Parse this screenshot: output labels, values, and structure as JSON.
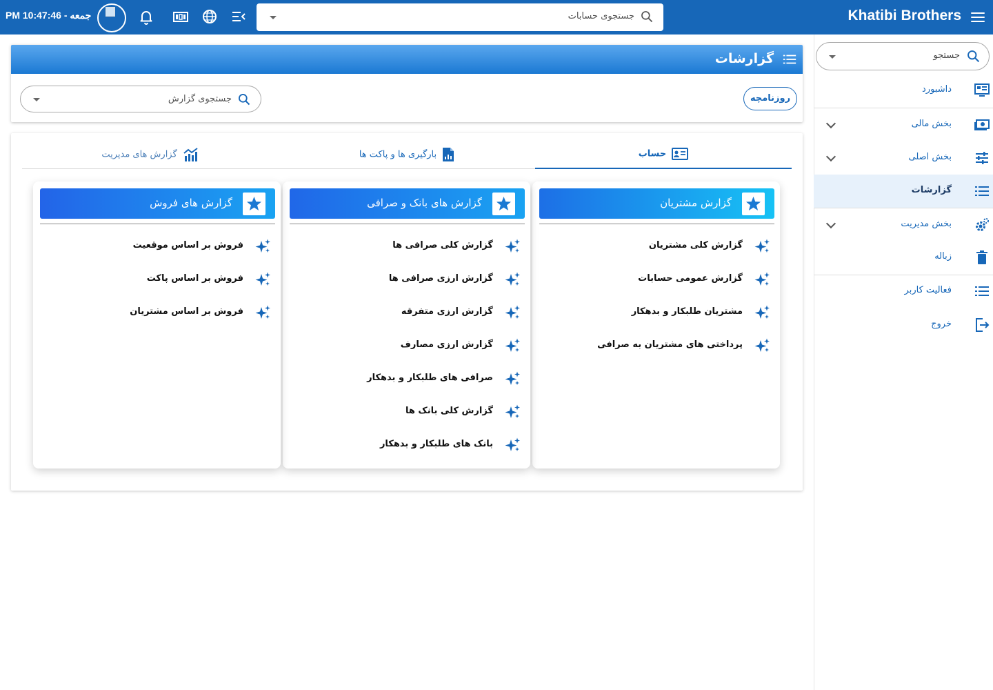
{
  "topbar": {
    "brand": "Khatibi Brothers",
    "search_placeholder": "جستجوی حسابات",
    "clock": "جمعه - 10:47:46 PM",
    "icons": [
      "menu-icon",
      "search-icon",
      "collapse-menu-icon",
      "globe-icon",
      "currency-icon",
      "bell-icon",
      "avatar"
    ]
  },
  "sidebar": {
    "search_placeholder": "جستجو",
    "items": [
      {
        "label": "داشبورد",
        "icon": "dashboard-icon"
      },
      {
        "label": "بخش مالی",
        "icon": "money-icon",
        "expandable": true
      },
      {
        "label": "بخش اصلی",
        "icon": "settings-sliders-icon",
        "expandable": true
      },
      {
        "label": "گزارشات",
        "icon": "list-icon",
        "active": true
      },
      {
        "label": "بخش مدیریت",
        "icon": "gears-icon",
        "expandable": true
      },
      {
        "label": "زباله",
        "icon": "trash-icon"
      },
      {
        "label": "فعالیت کاربر",
        "icon": "list-icon"
      },
      {
        "label": "خروج",
        "icon": "logout-icon"
      }
    ]
  },
  "page": {
    "title": "گزارشات",
    "journal_button": "روزنامچه",
    "report_search_placeholder": "جستجوی گزارش"
  },
  "tabs": [
    {
      "label": "حساب",
      "icon": "contact-card-icon",
      "active": true
    },
    {
      "label": "بارگیری ها و پاکت ها",
      "icon": "document-chart-icon"
    },
    {
      "label": "گزارش های مدیریت",
      "icon": "chart-trend-icon"
    }
  ],
  "columns": [
    {
      "title": "گزارش مشتریان",
      "gradient": [
        "#1d6fe6",
        "#17c2f5"
      ],
      "items": [
        "گزارش کلی مشتریان",
        "گزارش عمومی حسابات",
        "مشتریان طلبکار و بدهکار",
        "پرداختی های مشتریان به صرافی"
      ]
    },
    {
      "title": "گزارش های بانک و صرافی",
      "gradient": [
        "#2067e8",
        "#1aa3f2"
      ],
      "items": [
        "گزارش کلی صرافی ها",
        "گزارش ارزی صرافی ها",
        "گزارش ارزی متفرقه",
        "گزارش ارزی مصارف",
        "صرافی های طلبکار و بدهکار",
        "گزارش کلی بانک ها",
        "بانک های طلبکار و بدهکار"
      ]
    },
    {
      "title": "گزارش های فروش",
      "gradient": [
        "#2364e8",
        "#1aa3f2"
      ],
      "items": [
        "فروش بر اساس موقعیت",
        "فروش بر اساس پاکت",
        "فروش بر اساس مشتریان"
      ]
    }
  ],
  "colors": {
    "primary": "#1767b8",
    "accent": "#1b79d3",
    "active_bg": "#e7f1fb",
    "sparkle": "#1767b8"
  }
}
